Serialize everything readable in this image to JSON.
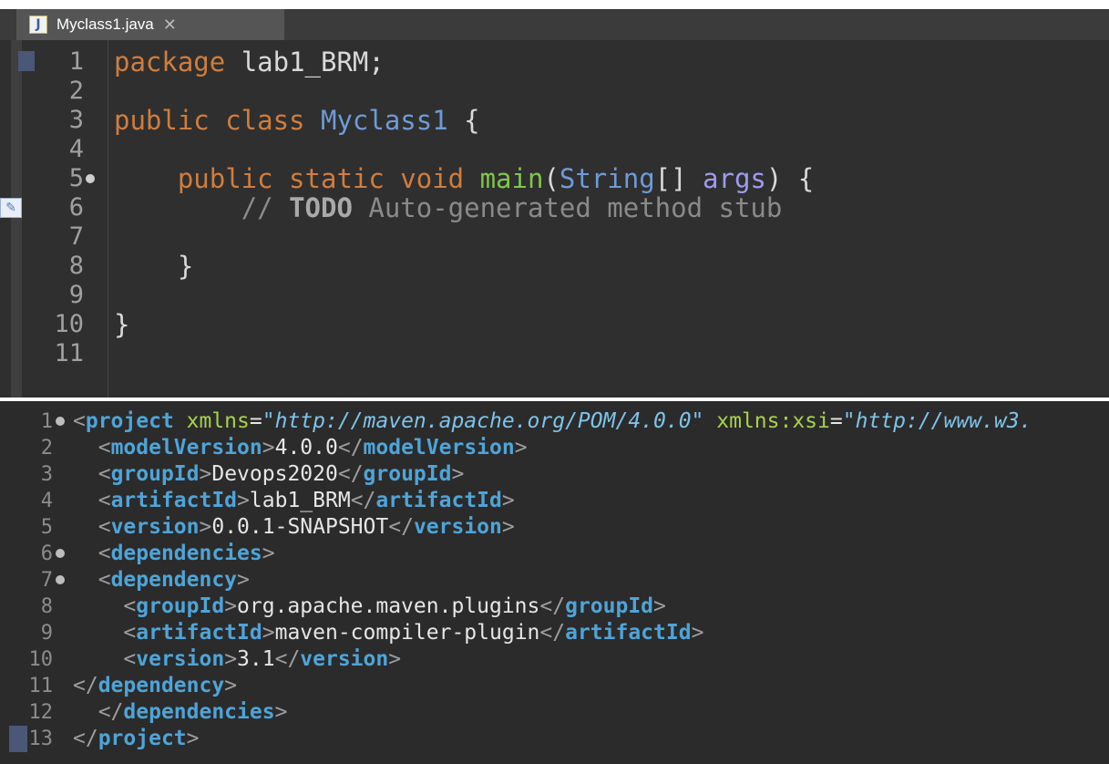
{
  "java_editor": {
    "tab_label": "Myclass1.java",
    "file_icon": "java-file-icon",
    "close_icon": "close-x-icon",
    "lines": [
      {
        "num": "1",
        "tokens": [
          {
            "c": "kw",
            "t": "package "
          },
          {
            "c": "plain",
            "t": "lab1_BRM;"
          }
        ]
      },
      {
        "num": "2",
        "tokens": []
      },
      {
        "num": "3",
        "tokens": [
          {
            "c": "kw",
            "t": "public class "
          },
          {
            "c": "type",
            "t": "Myclass1 "
          },
          {
            "c": "plain",
            "t": "{"
          }
        ]
      },
      {
        "num": "4",
        "tokens": []
      },
      {
        "num": "5",
        "fold": true,
        "tokens": [
          {
            "c": "plain",
            "t": "    "
          },
          {
            "c": "kw",
            "t": "public static void "
          },
          {
            "c": "method",
            "t": "main"
          },
          {
            "c": "plain",
            "t": "("
          },
          {
            "c": "type",
            "t": "String"
          },
          {
            "c": "plain",
            "t": "[] "
          },
          {
            "c": "ident",
            "t": "args"
          },
          {
            "c": "plain",
            "t": ") {"
          }
        ]
      },
      {
        "num": "6",
        "task": true,
        "tokens": [
          {
            "c": "plain",
            "t": "        "
          },
          {
            "c": "comment",
            "t": "// "
          },
          {
            "c": "todo",
            "t": "TODO"
          },
          {
            "c": "comment",
            "t": " Auto-generated method stub"
          }
        ]
      },
      {
        "num": "7",
        "tokens": []
      },
      {
        "num": "8",
        "tokens": [
          {
            "c": "plain",
            "t": "    }"
          }
        ]
      },
      {
        "num": "9",
        "tokens": []
      },
      {
        "num": "10",
        "tokens": [
          {
            "c": "plain",
            "t": "}"
          }
        ]
      },
      {
        "num": "11",
        "tokens": []
      }
    ]
  },
  "xml_editor": {
    "lines": [
      {
        "num": "1",
        "fold": true,
        "tokens": [
          {
            "c": "bracket",
            "t": "<"
          },
          {
            "c": "tag",
            "t": "project"
          },
          {
            "c": "attr",
            "t": " xmlns"
          },
          {
            "c": "xtext",
            "t": "="
          },
          {
            "c": "val",
            "t": "\"http://maven.apache.org/POM/4.0.0\""
          },
          {
            "c": "attr",
            "t": " xmlns:xsi"
          },
          {
            "c": "xtext",
            "t": "="
          },
          {
            "c": "val",
            "t": "\"http://www.w3."
          }
        ]
      },
      {
        "num": "2",
        "tokens": [
          {
            "c": "xtext",
            "t": "  "
          },
          {
            "c": "bracket",
            "t": "<"
          },
          {
            "c": "tag",
            "t": "modelVersion"
          },
          {
            "c": "bracket",
            "t": ">"
          },
          {
            "c": "xtext",
            "t": "4.0.0"
          },
          {
            "c": "bracket",
            "t": "</"
          },
          {
            "c": "tag",
            "t": "modelVersion"
          },
          {
            "c": "bracket",
            "t": ">"
          }
        ]
      },
      {
        "num": "3",
        "tokens": [
          {
            "c": "xtext",
            "t": "  "
          },
          {
            "c": "bracket",
            "t": "<"
          },
          {
            "c": "tag",
            "t": "groupId"
          },
          {
            "c": "bracket",
            "t": ">"
          },
          {
            "c": "xtext",
            "t": "Devops2020"
          },
          {
            "c": "bracket",
            "t": "</"
          },
          {
            "c": "tag",
            "t": "groupId"
          },
          {
            "c": "bracket",
            "t": ">"
          }
        ]
      },
      {
        "num": "4",
        "tokens": [
          {
            "c": "xtext",
            "t": "  "
          },
          {
            "c": "bracket",
            "t": "<"
          },
          {
            "c": "tag",
            "t": "artifactId"
          },
          {
            "c": "bracket",
            "t": ">"
          },
          {
            "c": "xtext",
            "t": "lab1_BRM"
          },
          {
            "c": "bracket",
            "t": "</"
          },
          {
            "c": "tag",
            "t": "artifactId"
          },
          {
            "c": "bracket",
            "t": ">"
          }
        ]
      },
      {
        "num": "5",
        "tokens": [
          {
            "c": "xtext",
            "t": "  "
          },
          {
            "c": "bracket",
            "t": "<"
          },
          {
            "c": "tag",
            "t": "version"
          },
          {
            "c": "bracket",
            "t": ">"
          },
          {
            "c": "xtext",
            "t": "0.0.1-SNAPSHOT"
          },
          {
            "c": "bracket",
            "t": "</"
          },
          {
            "c": "tag",
            "t": "version"
          },
          {
            "c": "bracket",
            "t": ">"
          }
        ]
      },
      {
        "num": "6",
        "fold": true,
        "tokens": [
          {
            "c": "xtext",
            "t": "  "
          },
          {
            "c": "bracket",
            "t": "<"
          },
          {
            "c": "tag",
            "t": "dependencies"
          },
          {
            "c": "bracket",
            "t": ">"
          }
        ]
      },
      {
        "num": "7",
        "fold": true,
        "tokens": [
          {
            "c": "xtext",
            "t": "  "
          },
          {
            "c": "bracket",
            "t": "<"
          },
          {
            "c": "tag",
            "t": "dependency"
          },
          {
            "c": "bracket",
            "t": ">"
          }
        ]
      },
      {
        "num": "8",
        "tokens": [
          {
            "c": "xtext",
            "t": "    "
          },
          {
            "c": "bracket",
            "t": "<"
          },
          {
            "c": "tag",
            "t": "groupId"
          },
          {
            "c": "bracket",
            "t": ">"
          },
          {
            "c": "xtext",
            "t": "org.apache.maven.plugins"
          },
          {
            "c": "bracket",
            "t": "</"
          },
          {
            "c": "tag",
            "t": "groupId"
          },
          {
            "c": "bracket",
            "t": ">"
          }
        ]
      },
      {
        "num": "9",
        "tokens": [
          {
            "c": "xtext",
            "t": "    "
          },
          {
            "c": "bracket",
            "t": "<"
          },
          {
            "c": "tag",
            "t": "artifactId"
          },
          {
            "c": "bracket",
            "t": ">"
          },
          {
            "c": "xtext",
            "t": "maven-compiler-plugin"
          },
          {
            "c": "bracket",
            "t": "</"
          },
          {
            "c": "tag",
            "t": "artifactId"
          },
          {
            "c": "bracket",
            "t": ">"
          }
        ]
      },
      {
        "num": "10",
        "tokens": [
          {
            "c": "xtext",
            "t": "    "
          },
          {
            "c": "bracket",
            "t": "<"
          },
          {
            "c": "tag",
            "t": "version"
          },
          {
            "c": "bracket",
            "t": ">"
          },
          {
            "c": "xtext",
            "t": "3.1"
          },
          {
            "c": "bracket",
            "t": "</"
          },
          {
            "c": "tag",
            "t": "version"
          },
          {
            "c": "bracket",
            "t": ">"
          }
        ]
      },
      {
        "num": "11",
        "tokens": [
          {
            "c": "bracket",
            "t": "</"
          },
          {
            "c": "tag",
            "t": "dependency"
          },
          {
            "c": "bracket",
            "t": ">"
          }
        ]
      },
      {
        "num": "12",
        "tokens": [
          {
            "c": "xtext",
            "t": "  "
          },
          {
            "c": "bracket",
            "t": "</"
          },
          {
            "c": "tag",
            "t": "dependencies"
          },
          {
            "c": "bracket",
            "t": ">"
          }
        ]
      },
      {
        "num": "13",
        "tokens": [
          {
            "c": "bracket",
            "t": "</"
          },
          {
            "c": "tag",
            "t": "project"
          },
          {
            "c": "bracket",
            "t": ">"
          }
        ]
      }
    ]
  }
}
